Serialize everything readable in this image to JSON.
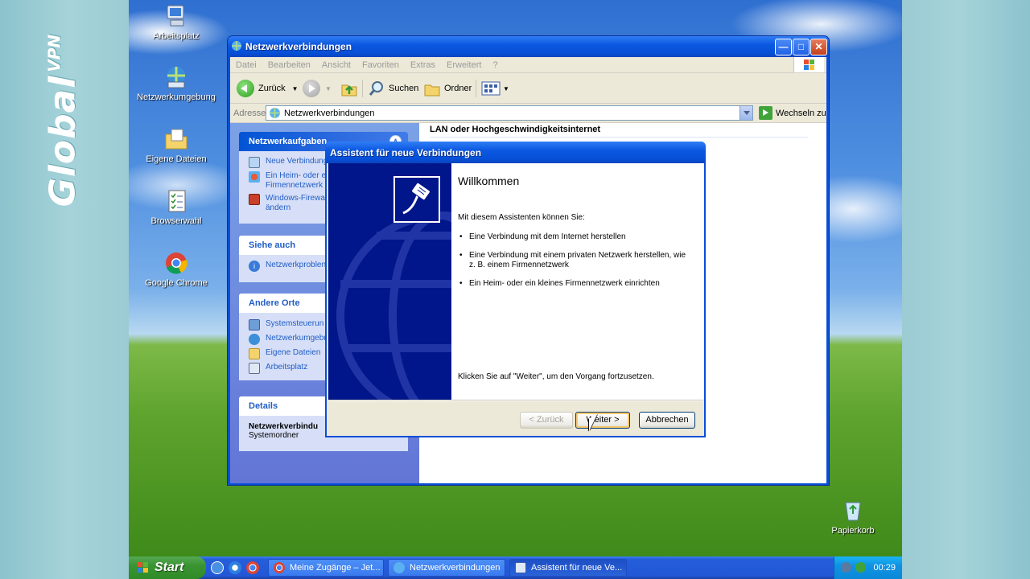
{
  "brand": {
    "word": "Global",
    "sub": "VPN"
  },
  "desktop": {
    "icons": [
      {
        "label": "Arbeitsplatz",
        "icon": "computer-icon"
      },
      {
        "label": "Netzwerkumgebung",
        "icon": "network-places-icon"
      },
      {
        "label": "Eigene Dateien",
        "icon": "documents-folder-icon"
      },
      {
        "label": "Browserwahl",
        "icon": "browser-choice-icon"
      },
      {
        "label": "Google Chrome",
        "icon": "chrome-icon"
      },
      {
        "label": "Papierkorb",
        "icon": "recycle-bin-icon"
      }
    ]
  },
  "window": {
    "title": "Netzwerkverbindungen",
    "menu": [
      "Datei",
      "Bearbeiten",
      "Ansicht",
      "Favoriten",
      "Extras",
      "Erweitert",
      "?"
    ],
    "toolbar": {
      "back": "Zurück",
      "search": "Suchen",
      "folders": "Ordner"
    },
    "address": {
      "label": "Adresse",
      "value": "Netzwerkverbindungen",
      "go": "Wechseln zu"
    },
    "section_heading": "LAN oder Hochgeschwindigkeitsinternet",
    "taskpane": {
      "network_tasks": {
        "title": "Netzwerkaufgaben",
        "items": [
          "Neue Verbindung",
          "Ein Heim- oder ei\nFirmennetzwerk",
          "Windows-Firewa\nändern"
        ]
      },
      "see_also": {
        "title": "Siehe auch",
        "items": [
          "Netzwerkproblen"
        ]
      },
      "other_places": {
        "title": "Andere Orte",
        "items": [
          "Systemsteuerun",
          "Netzwerkumgebu",
          "Eigene Dateien",
          "Arbeitsplatz"
        ]
      },
      "details": {
        "title": "Details",
        "name": "Netzwerkverbindu",
        "type": "Systemordner"
      }
    }
  },
  "wizard": {
    "title": "Assistent für neue Verbindungen",
    "heading": "Willkommen",
    "intro": "Mit diesem Assistenten können Sie:",
    "bullets": [
      "Eine Verbindung mit dem Internet herstellen",
      "Eine Verbindung mit einem privaten Netzwerk herstellen, wie z. B. einem Firmennetzwerk",
      "Ein Heim- oder ein kleines Firmennetzwerk einrichten"
    ],
    "footer": "Klicken Sie auf \"Weiter\", um den Vorgang fortzusetzen.",
    "buttons": {
      "back": "< Zurück",
      "next": "Weiter >",
      "cancel": "Abbrechen"
    }
  },
  "taskbar": {
    "start": "Start",
    "tasks": [
      "Meine Zugänge – Jet...",
      "Netzwerkverbindungen",
      "Assistent für neue Ve..."
    ],
    "clock": "00:29"
  }
}
